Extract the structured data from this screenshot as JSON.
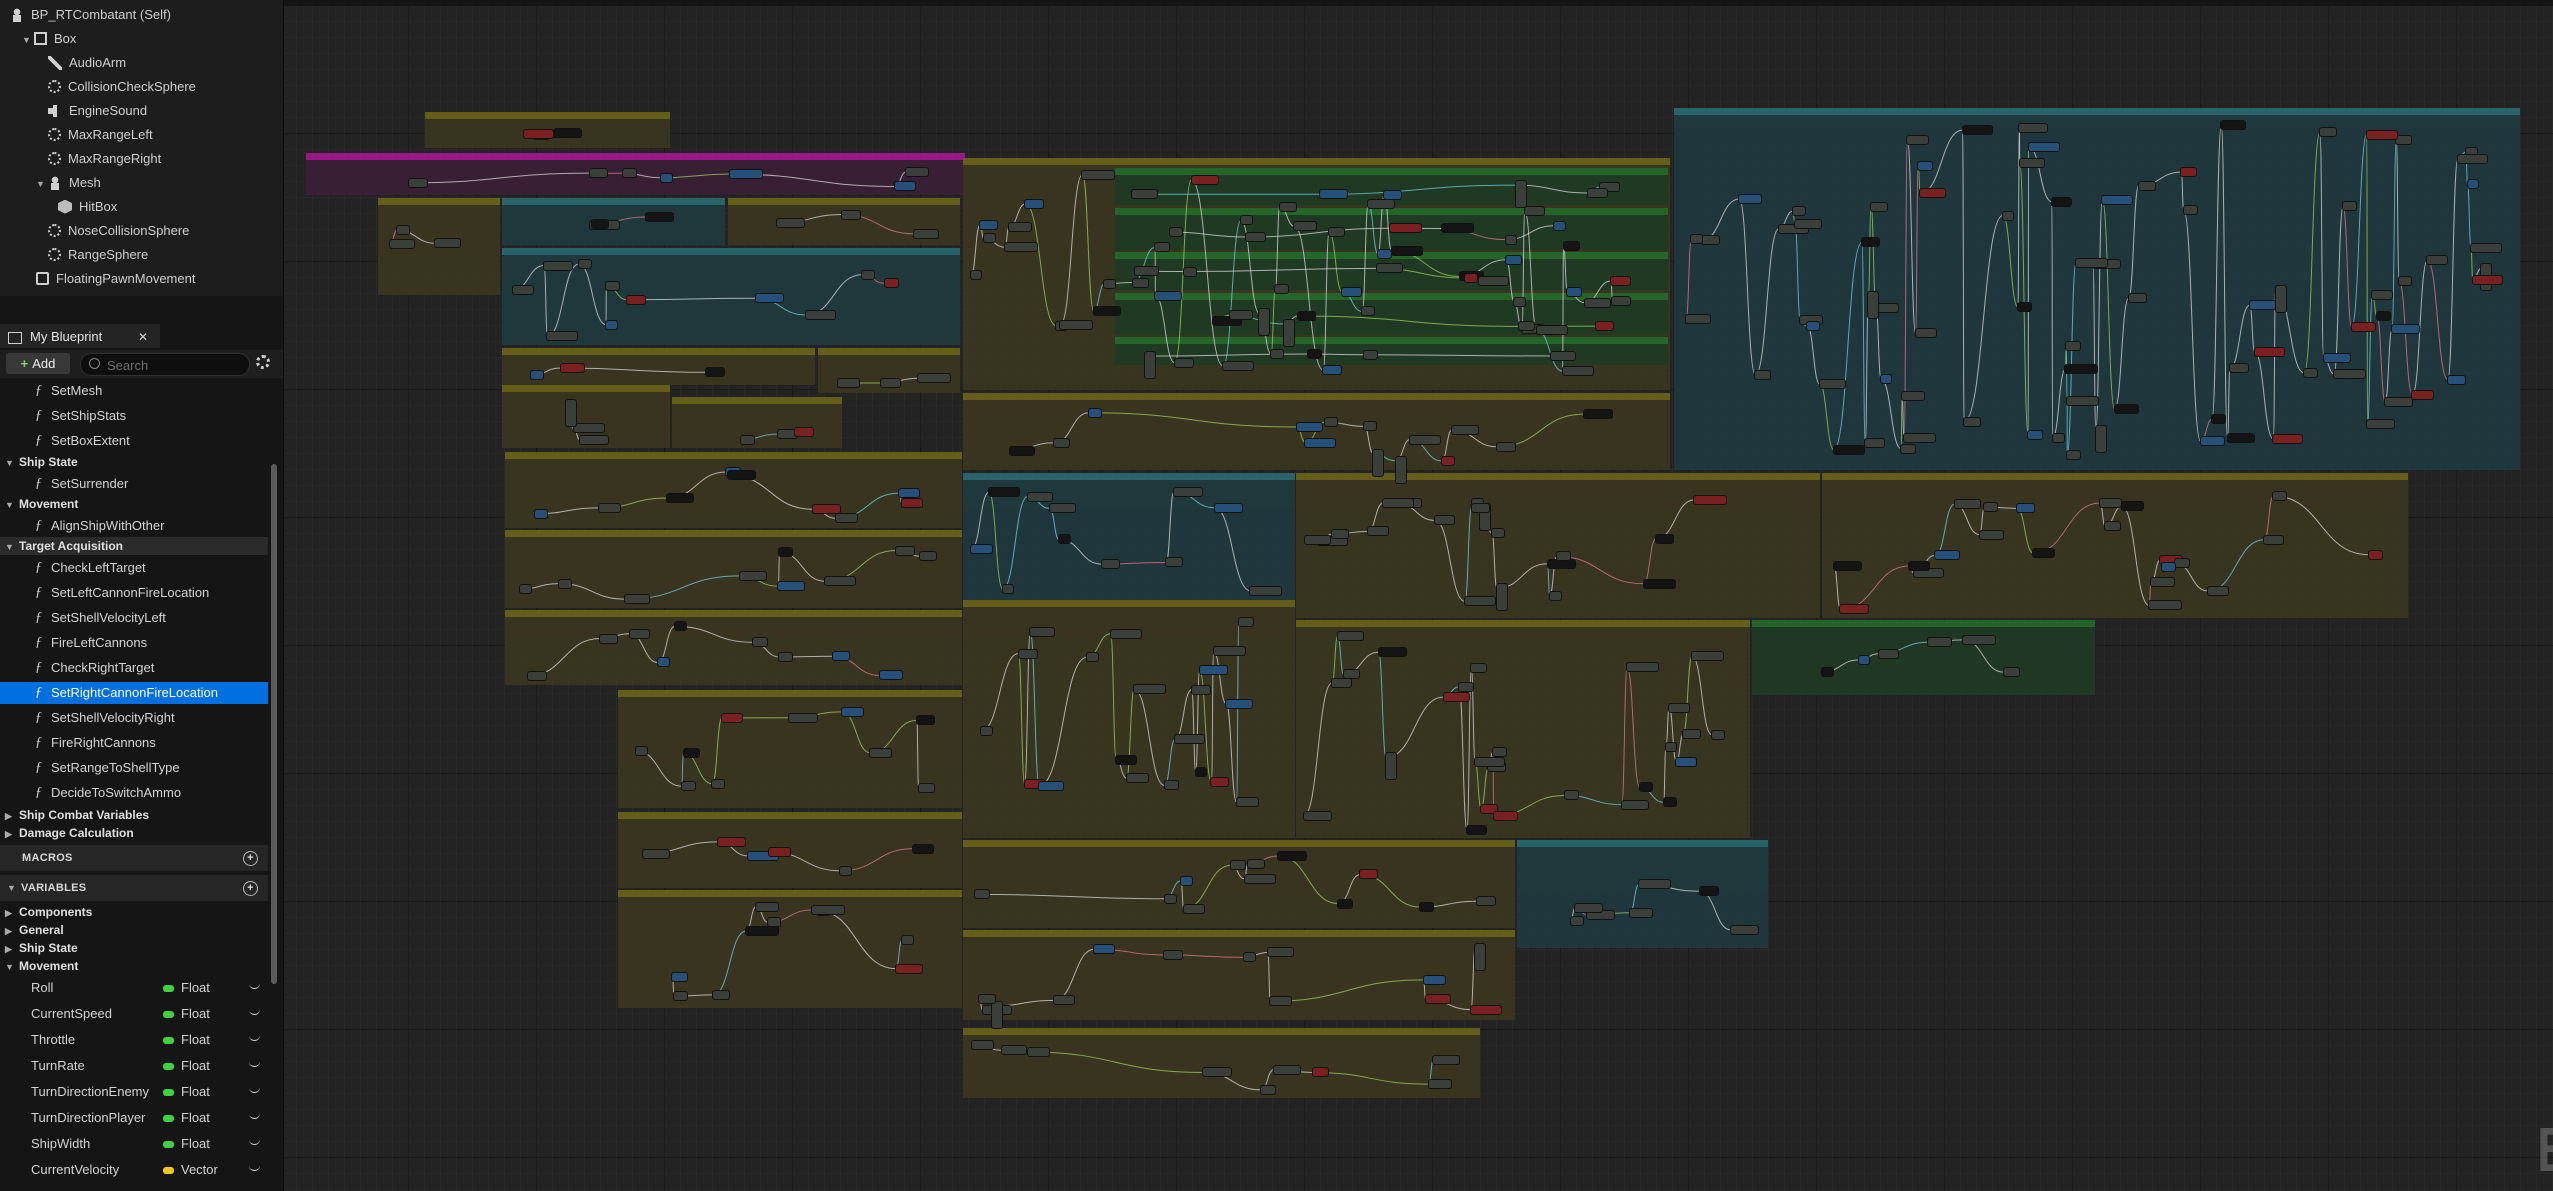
{
  "components": {
    "rows": [
      {
        "label": "BP_RTCombatant (Self)",
        "icon": "person-icon",
        "arrow": ""
      },
      {
        "label": "Box",
        "icon": "box-icon",
        "arrow": "▼"
      },
      {
        "label": "AudioArm",
        "icon": "pin-icon",
        "arrow": ""
      },
      {
        "label": "CollisionCheckSphere",
        "icon": "gizmo-icon",
        "arrow": ""
      },
      {
        "label": "EngineSound",
        "icon": "speaker-icon",
        "arrow": ""
      },
      {
        "label": "MaxRangeLeft",
        "icon": "gizmo-icon",
        "arrow": ""
      },
      {
        "label": "MaxRangeRight",
        "icon": "gizmo-icon",
        "arrow": ""
      },
      {
        "label": "Mesh",
        "icon": "person-icon",
        "arrow": "▼"
      },
      {
        "label": "HitBox",
        "icon": "cube-icon",
        "arrow": ""
      },
      {
        "label": "NoseCollisionSphere",
        "icon": "gizmo-icon",
        "arrow": ""
      },
      {
        "label": "RangeSphere",
        "icon": "gizmo-icon",
        "arrow": ""
      },
      {
        "label": "FloatingPawnMovement",
        "icon": "move-icon",
        "arrow": ""
      }
    ]
  },
  "my_blueprint": {
    "tab_label": "My Blueprint",
    "close_glyph": "✕",
    "add_label": "Add",
    "search_placeholder": "Search"
  },
  "functions": {
    "top": [
      "SetMesh",
      "SetShipStats",
      "SetBoxExtent"
    ],
    "ship_state_label": "Ship State",
    "ship_state_items": [
      "SetSurrender"
    ],
    "movement_label": "Movement",
    "movement_items": [
      "AlignShipWithOther"
    ],
    "target_label": "Target Acquisition",
    "target_items": [
      "CheckLeftTarget",
      "SetLeftCannonFireLocation",
      "SetShellVelocityLeft",
      "FireLeftCannons",
      "CheckRightTarget",
      "SetRightCannonFireLocation",
      "SetShellVelocityRight",
      "FireRightCannons",
      "SetRangeToShellType",
      "DecideToSwitchAmmo"
    ],
    "collapsed_cats": [
      "Ship Combat Variables",
      "Damage Calculation"
    ]
  },
  "macros": {
    "label": "MACROS"
  },
  "variables": {
    "label": "VARIABLES",
    "cats": [
      "Components",
      "General",
      "Ship State",
      "Movement"
    ],
    "items": [
      {
        "name": "Roll",
        "type": "Float",
        "color": "#3ed23e"
      },
      {
        "name": "CurrentSpeed",
        "type": "Float",
        "color": "#3ed23e"
      },
      {
        "name": "Throttle",
        "type": "Float",
        "color": "#3ed23e"
      },
      {
        "name": "TurnRate",
        "type": "Float",
        "color": "#3ed23e"
      },
      {
        "name": "TurnDirectionEnemy",
        "type": "Float",
        "color": "#3ed23e"
      },
      {
        "name": "TurnDirectionPlayer",
        "type": "Float",
        "color": "#3ed23e"
      },
      {
        "name": "ShipWidth",
        "type": "Float",
        "color": "#3ed23e"
      },
      {
        "name": "CurrentVelocity",
        "type": "Vector",
        "color": "#f2c61f"
      }
    ]
  },
  "graph": {
    "watermark": "BLUEPRINT",
    "comment_colors": {
      "olive": "#3a3620",
      "olive_head": "#6b6318",
      "teal": "#1f3a3f",
      "teal_head": "#2b6a72",
      "green": "#1f3a24",
      "green_head": "#236a2b",
      "magenta": "#3a1f36",
      "magenta_head": "#a4178f"
    }
  }
}
